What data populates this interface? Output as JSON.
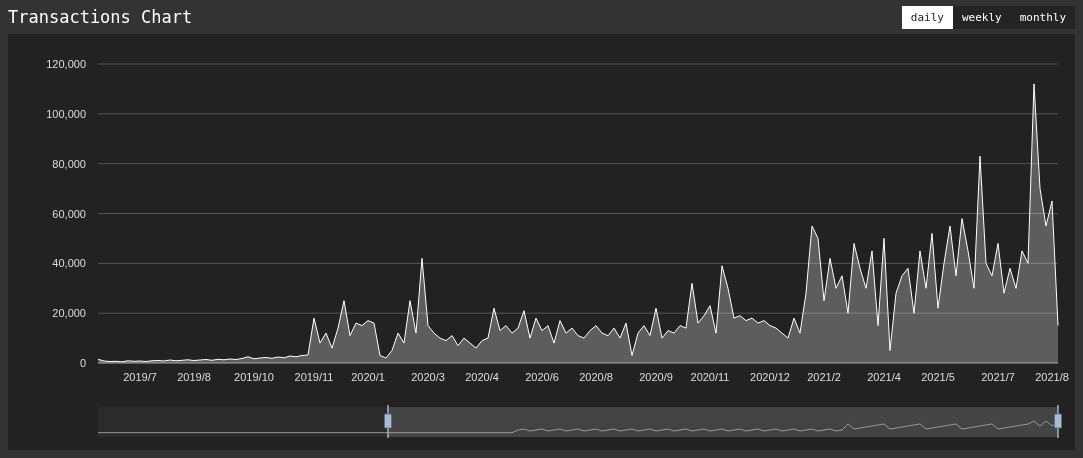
{
  "title": "Transactions Chart",
  "tabs": [
    {
      "label": "daily",
      "selected": true
    },
    {
      "label": "weekly",
      "selected": false
    },
    {
      "label": "monthly",
      "selected": false
    }
  ],
  "chart_data": {
    "type": "area",
    "grid": true,
    "ylim": [
      0,
      120000
    ],
    "categories": [
      null,
      null,
      null,
      null,
      null,
      null,
      null,
      "2019/7",
      null,
      null,
      null,
      null,
      null,
      null,
      null,
      null,
      "2019/8",
      null,
      null,
      null,
      null,
      null,
      null,
      null,
      null,
      null,
      "2019/10",
      null,
      null,
      null,
      null,
      null,
      null,
      null,
      null,
      null,
      "2019/11",
      null,
      null,
      null,
      null,
      null,
      null,
      null,
      null,
      "2020/1",
      null,
      null,
      null,
      null,
      null,
      null,
      null,
      null,
      null,
      "2020/3",
      null,
      null,
      null,
      null,
      null,
      null,
      null,
      null,
      "2020/4",
      null,
      null,
      null,
      null,
      null,
      null,
      null,
      null,
      null,
      "2020/6",
      null,
      null,
      null,
      null,
      null,
      null,
      null,
      null,
      "2020/8",
      null,
      null,
      null,
      null,
      null,
      null,
      null,
      null,
      null,
      "2020/9",
      null,
      null,
      null,
      null,
      null,
      null,
      null,
      null,
      "2020/11",
      null,
      null,
      null,
      null,
      null,
      null,
      null,
      null,
      null,
      "2020/12",
      null,
      null,
      null,
      null,
      null,
      null,
      null,
      null,
      "2021/2",
      null,
      null,
      null,
      null,
      null,
      null,
      null,
      null,
      null,
      "2021/4",
      null,
      null,
      null,
      null,
      null,
      null,
      null,
      null,
      "2021/5",
      null,
      null,
      null,
      null,
      null,
      null,
      null,
      null,
      null,
      "2021/7",
      null,
      null,
      null,
      null,
      null,
      null,
      null,
      null,
      "2021/8",
      null
    ],
    "yticks": [
      {
        "value": 0,
        "label": "0"
      },
      {
        "value": 20000,
        "label": "20,000"
      },
      {
        "value": 40000,
        "label": "40,000"
      },
      {
        "value": 60000,
        "label": "60,000"
      },
      {
        "value": 80000,
        "label": "80,000"
      },
      {
        "value": 100000,
        "label": "100,000"
      },
      {
        "value": 120000,
        "label": "120,000"
      }
    ],
    "series": [
      {
        "color": "#ffffff",
        "values": [
          1500,
          800,
          600,
          700,
          500,
          900,
          700,
          800,
          600,
          900,
          1000,
          800,
          1200,
          900,
          1100,
          1300,
          1000,
          1200,
          1400,
          1100,
          1500,
          1300,
          1600,
          1400,
          1800,
          2500,
          1700,
          2000,
          2200,
          1900,
          2400,
          2100,
          2800,
          2500,
          3000,
          3200,
          18000,
          8000,
          12000,
          6000,
          14000,
          25000,
          11000,
          16000,
          15000,
          17000,
          16000,
          3000,
          2000,
          5000,
          12000,
          8000,
          25000,
          12000,
          42000,
          15000,
          12000,
          10000,
          9000,
          11000,
          7000,
          10000,
          8000,
          6000,
          9000,
          10000,
          22000,
          13000,
          15000,
          12000,
          14000,
          21000,
          10000,
          18000,
          13000,
          15000,
          8000,
          17000,
          12000,
          14000,
          11000,
          10000,
          13000,
          15000,
          12000,
          11000,
          14000,
          10000,
          16000,
          3000,
          12000,
          15000,
          11000,
          22000,
          10000,
          13000,
          12000,
          15000,
          14000,
          32000,
          16000,
          19000,
          23000,
          12000,
          39000,
          30000,
          18000,
          19000,
          17000,
          18000,
          16000,
          17000,
          15000,
          14000,
          12000,
          10000,
          18000,
          12000,
          28000,
          55000,
          50000,
          25000,
          42000,
          30000,
          35000,
          20000,
          48000,
          38000,
          30000,
          45000,
          15000,
          50000,
          5000,
          28000,
          35000,
          38000,
          20000,
          45000,
          30000,
          52000,
          22000,
          40000,
          55000,
          35000,
          58000,
          45000,
          30000,
          83000,
          40000,
          35000,
          48000,
          28000,
          38000,
          30000,
          45000,
          40000,
          112000,
          70000,
          55000,
          65000,
          15000
        ]
      }
    ]
  }
}
